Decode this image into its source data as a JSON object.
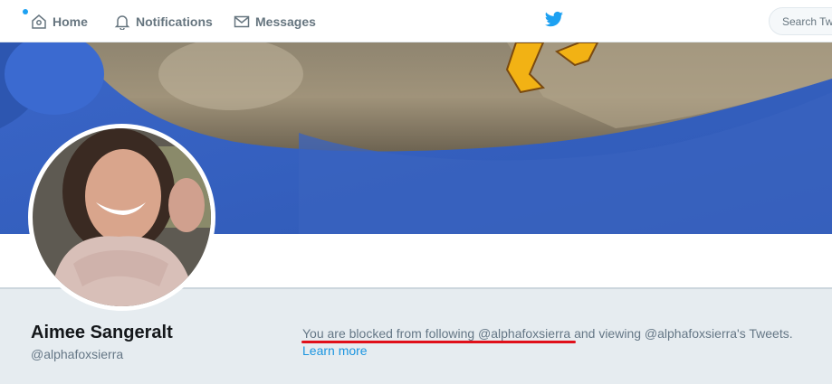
{
  "nav": {
    "home_label": "Home",
    "notifications_label": "Notifications",
    "messages_label": "Messages",
    "search_placeholder": "Search Twitter"
  },
  "profile": {
    "name": "Aimee Sangeralt",
    "handle": "@alphafoxsierra"
  },
  "notice": {
    "text": "You are blocked from following @alphafoxsierra and viewing @alphafoxsierra's Tweets.",
    "learn_more": "Learn more"
  },
  "colors": {
    "accent": "#1da1f2",
    "link": "#1b95e0",
    "annotation_underline": "#e0101a",
    "page_bg": "#e6ecf0"
  }
}
